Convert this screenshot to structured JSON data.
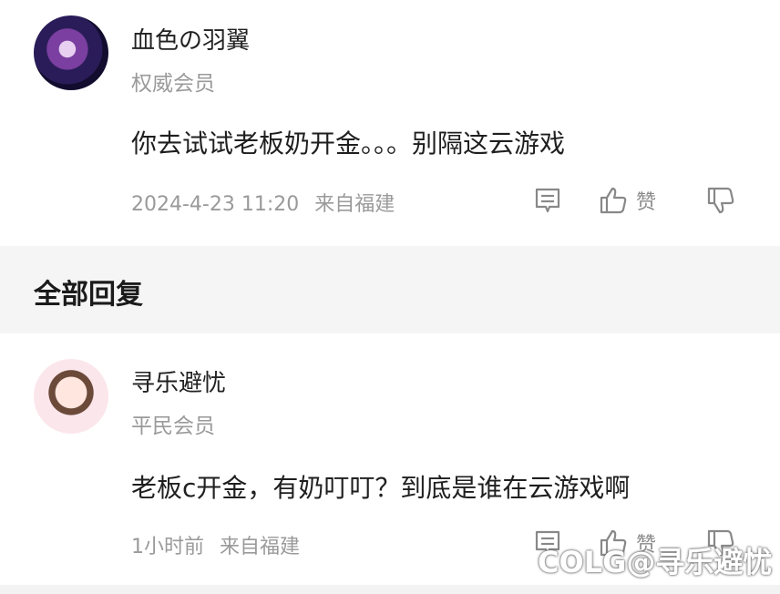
{
  "comments": [
    {
      "user": "血色の羽翼",
      "level": "权威会员",
      "text": "你去试试老板奶开金。。。别隔这云游戏",
      "time": "2024-4-23 11:20",
      "location": "来自福建",
      "like_label": "赞"
    },
    {
      "user": "寻乐避忧",
      "level": "平民会员",
      "text": "老板c开金，有奶叮叮？到底是谁在云游戏啊",
      "time": "1小时前",
      "location": "来自福建",
      "like_label": "赞"
    }
  ],
  "section_title": "全部回复",
  "watermark": "COLG@寻乐避忧",
  "icons": [
    "comment-icon",
    "thumbs-up-icon",
    "thumbs-down-icon"
  ]
}
